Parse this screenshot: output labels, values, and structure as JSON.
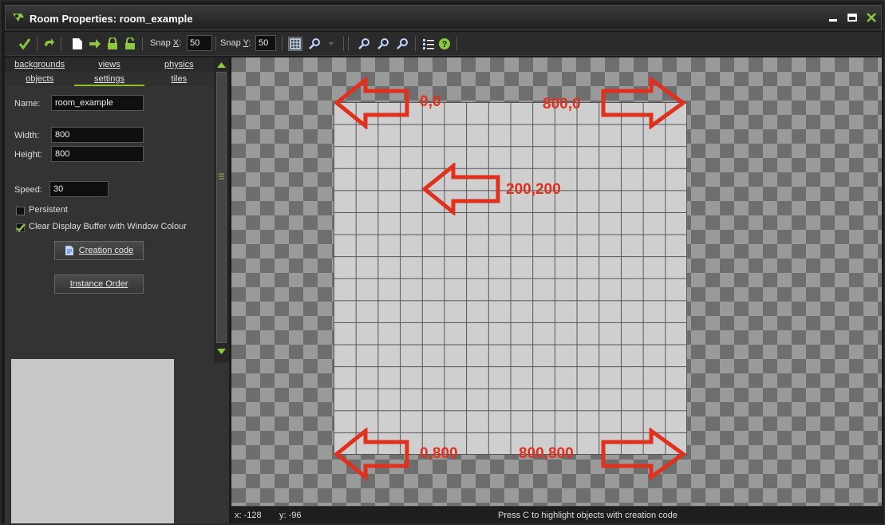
{
  "window": {
    "title": "Room Properties: room_example",
    "accent": "#90c020"
  },
  "toolbar": {
    "icons": [
      "ok-check-icon",
      "undo-icon",
      "clear-icon",
      "shift-icon",
      "lock-icon",
      "unlock-icon",
      "grid-icon",
      "zoom-icon",
      "zoom-out-icon",
      "zoom-reset-icon",
      "zoom-in-icon",
      "list-icon",
      "help-icon"
    ],
    "snap_x_label_pre": "Snap ",
    "snap_x_label_key": "X",
    "snap_x_label_post": ":",
    "snap_x_value": "50",
    "snap_y_label_pre": "Snap ",
    "snap_y_label_key": "Y",
    "snap_y_label_post": ":",
    "snap_y_value": "50"
  },
  "tabs": {
    "row1": [
      "backgrounds",
      "views",
      "physics"
    ],
    "row2": [
      "objects",
      "settings",
      "tiles"
    ],
    "active": "settings"
  },
  "settings": {
    "name_label": "Name:",
    "name_value": "room_example",
    "width_label": "Width:",
    "width_value": "800",
    "height_label": "Height:",
    "height_value": "800",
    "speed_label": "Speed:",
    "speed_value": "30",
    "persistent_label": "Persistent",
    "persistent_checked": false,
    "clear_display_label": "Clear Display Buffer with Window Colour",
    "clear_display_checked": true,
    "creation_code_button": "Creation code",
    "instance_order_button": "Instance Order"
  },
  "canvas": {
    "annotations": {
      "top_left": "0,0",
      "top_right": "800,0",
      "middle": "200,200",
      "bottom_left": "0,800",
      "bottom_right": "800,800"
    },
    "annotation_color": "#e0301e"
  },
  "status": {
    "x": "x: -128",
    "y": "y: -96",
    "message": "Press C to highlight objects with creation code"
  }
}
